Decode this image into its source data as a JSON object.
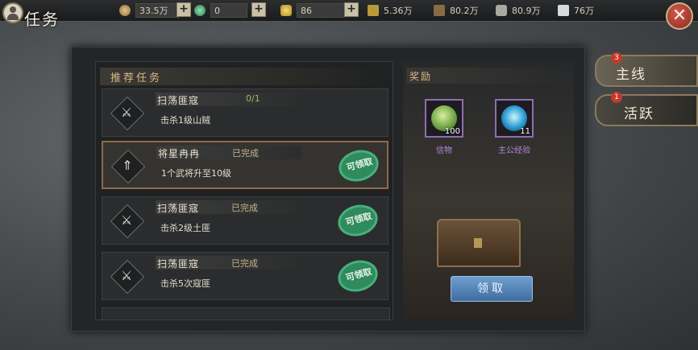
{
  "header": {
    "title": "任务",
    "resources": [
      {
        "icon": "copper-coin-icon",
        "value": "33.5万"
      },
      {
        "icon": "jade-icon",
        "value": "0"
      },
      {
        "icon": "gold-ingot-icon",
        "value": "86"
      },
      {
        "icon": "grain-icon",
        "value": "5.36万"
      },
      {
        "icon": "wood-icon",
        "value": "80.2万"
      },
      {
        "icon": "stone-icon",
        "value": "80.9万"
      },
      {
        "icon": "iron-icon",
        "value": "76万"
      }
    ],
    "close_label": "✕"
  },
  "task_panel": {
    "section_title": "推荐任务",
    "tasks": [
      {
        "name": "扫荡匪寇",
        "status": "0/1",
        "desc": "击杀1级山贼",
        "claimable": false,
        "selected": false
      },
      {
        "name": "将星冉冉",
        "status": "已完成",
        "desc": "1个武将升至10级",
        "claimable": true,
        "selected": true
      },
      {
        "name": "扫荡匪寇",
        "status": "已完成",
        "desc": "击杀2级土匪",
        "claimable": true,
        "selected": false
      },
      {
        "name": "扫荡匪寇",
        "status": "已完成",
        "desc": "击杀5次寇匪",
        "claimable": true,
        "selected": false
      }
    ],
    "claimable_stamp": "可领取"
  },
  "reward_panel": {
    "title": "奖励",
    "items": [
      {
        "name": "信物",
        "count": "100",
        "icon": "token-icon"
      },
      {
        "name": "主公经验",
        "count": "11",
        "icon": "experience-orb-icon"
      }
    ],
    "claim_button": "领取"
  },
  "tabs": [
    {
      "label": "主线",
      "badge": "3",
      "active": true
    },
    {
      "label": "活跃",
      "badge": "1",
      "active": false
    }
  ],
  "colors": {
    "accent_gold": "#d9b88a",
    "stamp_green": "#2f8a5e",
    "button_blue": "#4f7fb3",
    "badge_red": "#c43a2a"
  }
}
